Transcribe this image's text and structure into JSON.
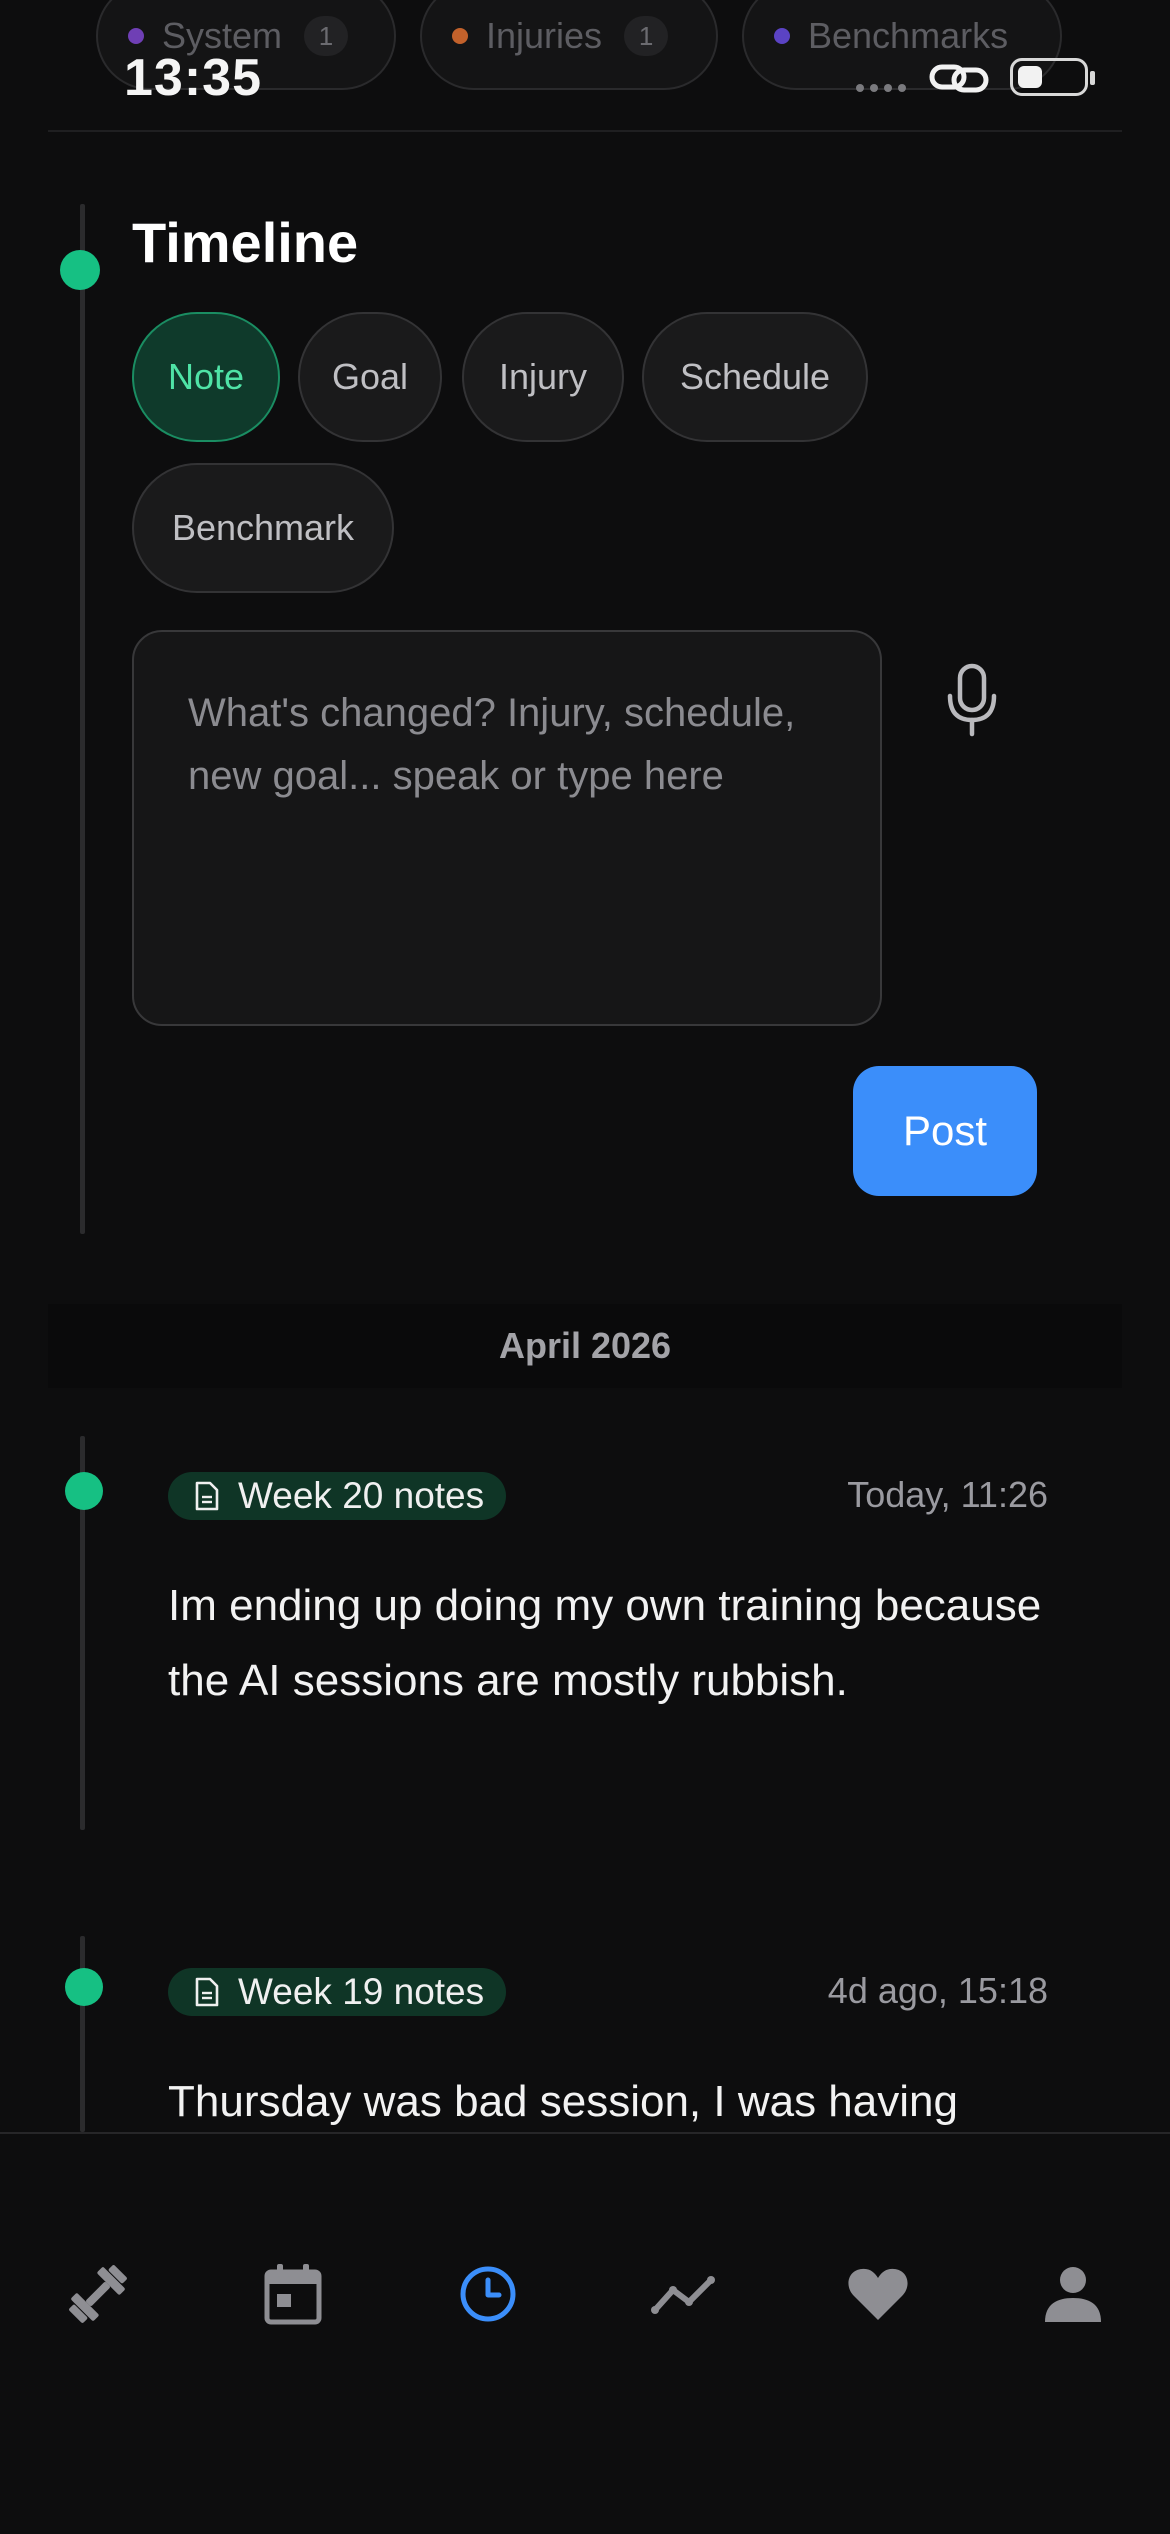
{
  "status_bar": {
    "time": "13:35"
  },
  "filters": [
    {
      "label": "System",
      "count": "1",
      "dot_color": "#6f3fb5"
    },
    {
      "label": "Injuries",
      "count": "1",
      "dot_color": "#c2612b"
    },
    {
      "label": "Benchmarks",
      "count": "",
      "dot_color": "#5b43c4"
    }
  ],
  "timeline": {
    "title": "Timeline",
    "types": [
      "Note",
      "Goal",
      "Injury",
      "Schedule",
      "Benchmark"
    ],
    "active_type": "Note",
    "input_placeholder": "What's changed? Injury, schedule, new goal... speak or type here",
    "input_value": "",
    "post_label": "Post"
  },
  "month_header": "April 2026",
  "entries": [
    {
      "badge": "Week 20 notes",
      "time": "Today, 11:26",
      "text": "Im ending up doing my own training because the AI sessions are mostly rubbish."
    },
    {
      "badge": "Week 19 notes",
      "time": "4d ago, 15:18",
      "text": "Thursday was bad session, I was having"
    }
  ],
  "nav": {
    "items": [
      "dumbbell-icon",
      "calendar-icon",
      "clock-icon",
      "trend-icon",
      "heart-icon",
      "person-icon"
    ],
    "active": "clock-icon"
  },
  "colors": {
    "accent_green": "#16c083",
    "accent_blue": "#3b8efa",
    "background": "#0d0d0e"
  }
}
